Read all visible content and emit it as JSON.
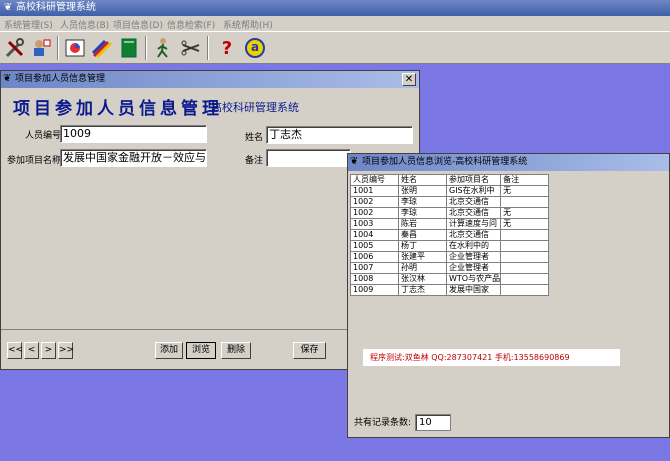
{
  "app": {
    "title": "高校科研管理系统"
  },
  "menu": [
    {
      "label": "系统管理(S)"
    },
    {
      "label": "人员信息(B)"
    },
    {
      "label": "项目信息(D)"
    },
    {
      "label": "信息检索(F)"
    },
    {
      "label": "系统帮助(H)"
    }
  ],
  "toolbar": {
    "icons": [
      "tools-icon",
      "user-settings-icon",
      "chart-icon",
      "pencils-icon",
      "book-icon",
      "walking-person-icon",
      "scissors-icon",
      "help-icon",
      "info-icon"
    ],
    "help_glyph": "?",
    "info_glyph": "a"
  },
  "edit_window": {
    "title": "项目参加人员信息管理",
    "close_glyph": "✕",
    "banner_big": "项目参加人员信息管理",
    "banner_small": "高校科研管理系统",
    "labels": {
      "person_id": "人员编号",
      "name": "姓名",
      "project_name": "参加项目名称",
      "remark": "备注"
    },
    "values": {
      "person_id": "1009",
      "name": "丁志杰",
      "project_name": "发展中国家金融开放－效应与",
      "remark": ""
    },
    "nav": {
      "first": "<<",
      "prev": "<",
      "next": ">",
      "last": ">>"
    },
    "buttons": {
      "add": "添加",
      "browse": "浏览",
      "delete": "删除",
      "save": "保存"
    }
  },
  "browse_window": {
    "title": "项目参加人员信息浏览-高校科研管理系统",
    "columns": [
      "人员编号",
      "姓名",
      "参加项目名",
      "备注"
    ],
    "rows": [
      [
        "1001",
        "张明",
        "GIS在水利中",
        "无"
      ],
      [
        "1002",
        "李琼",
        "北京交通信",
        ""
      ],
      [
        "1002",
        "李琼",
        "北京交通信",
        "无"
      ],
      [
        "1003",
        "陈岩",
        "计算速度与问",
        "无"
      ],
      [
        "1004",
        "秦昌",
        "北京交通信",
        ""
      ],
      [
        "1005",
        "杨丁",
        "在水利中的",
        ""
      ],
      [
        "1006",
        "张建平",
        "企业管理者",
        ""
      ],
      [
        "1007",
        "孙明",
        "企业管理者",
        ""
      ],
      [
        "1008",
        "张汉林",
        "WTO与农产品",
        ""
      ],
      [
        "1009",
        "丁志杰",
        "发展中国家",
        ""
      ]
    ],
    "credit": "程序测试:双鱼林 QQ:287307421 手机:13558690869",
    "count_label": "共有记录条数:",
    "count_value": "10"
  }
}
